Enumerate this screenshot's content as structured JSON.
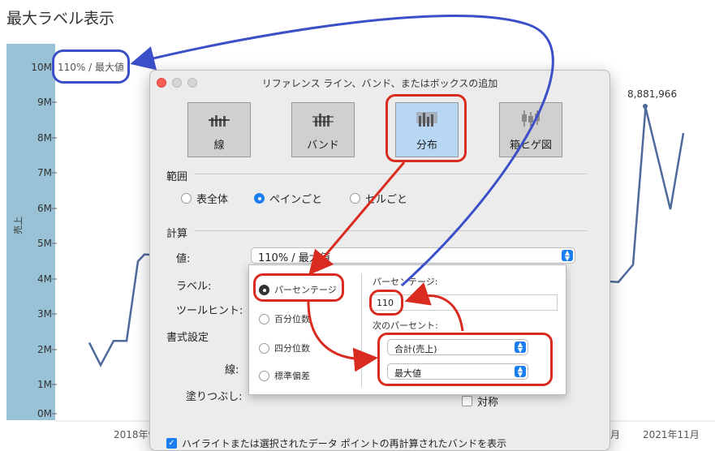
{
  "page": {
    "title": "最大ラベル表示"
  },
  "chart": {
    "y_axis_title": "売上",
    "y_ticks": [
      "10M",
      "9M",
      "8M",
      "7M",
      "6M",
      "5M",
      "4M",
      "3M",
      "2M",
      "1M",
      "0M"
    ],
    "x_labels": [
      "2018年9",
      "月",
      "2021年11月"
    ],
    "reference_label": "110% / 最大値",
    "peak_label": "8,881,966"
  },
  "chart_data": {
    "type": "line",
    "ylabel": "売上",
    "ylim": [
      0,
      10000000
    ],
    "x": [
      "2018年9月",
      "2021年11月"
    ],
    "series": [
      {
        "values": [
          2050000,
          1400000,
          2100000,
          2100000,
          4400000,
          4600000,
          3800000,
          4300000,
          8700000,
          8881966,
          5900000,
          8100000
        ]
      }
    ],
    "reference_line": {
      "label": "110% / 最大値"
    },
    "annotations": [
      "8,881,966"
    ]
  },
  "dialog": {
    "title": "リファレンス ライン、バンド、またはボックスの追加",
    "types": [
      {
        "label": "線",
        "icon": "line-type-icon"
      },
      {
        "label": "バンド",
        "icon": "band-type-icon"
      },
      {
        "label": "分布",
        "icon": "distribution-type-icon"
      },
      {
        "label": "箱ヒゲ図",
        "icon": "boxplot-type-icon"
      }
    ],
    "scope": {
      "heading": "範囲",
      "options": [
        "表全体",
        "ペインごと",
        "セルごと"
      ],
      "selected": "ペインごと"
    },
    "calc": {
      "heading": "計算",
      "value_label": "値:",
      "value": "110% / 最大値",
      "label_label": "ラベル:",
      "tooltip_label": "ツールヒント:"
    },
    "format": {
      "heading": "書式設定",
      "line_label": "線:",
      "fill_label": "塗りつぶし:",
      "symmetric_label": "対称"
    },
    "highlight_checkbox_label": "ハイライトまたは選択されたデータ ポイントの再計算されたバンドを表示"
  },
  "popup": {
    "options": [
      "パーセンテージ",
      "百分位数",
      "四分位数",
      "標準偏差"
    ],
    "selected": "パーセンテージ",
    "percentage_label": "パーセンテージ:",
    "percentage_value": "110",
    "of_label": "次のパーセント:",
    "measure": "合計(売上)",
    "aggregation": "最大値"
  },
  "colors": {
    "axis_band": "#99c2d6",
    "line": "#4e6a9a",
    "annotation_blue": "#3b4fc8",
    "annotation_red": "#d92b1f",
    "selected": "#b8d7f5",
    "accent": "#1a7ef0"
  }
}
